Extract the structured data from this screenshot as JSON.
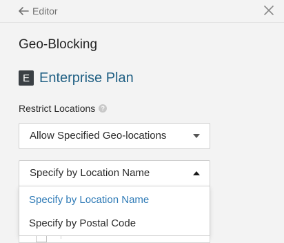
{
  "topbar": {
    "back_label": "Editor",
    "back_icon": "arrow-left-icon",
    "close_icon": "close-icon"
  },
  "page": {
    "title": "Geo-Blocking"
  },
  "plan": {
    "badge": "E",
    "name": "Enterprise Plan",
    "badge_color": "#3a3f44",
    "name_color": "#1f5f83"
  },
  "restrict": {
    "label": "Restrict Locations",
    "help_icon": "help-icon",
    "geo_select_value": "Allow Specified Geo-locations",
    "method_select_value": "Specify by Location Name",
    "method_options": [
      {
        "label": "Specify by Location Name",
        "selected": true
      },
      {
        "label": "Specify by Postal Code",
        "selected": false
      }
    ]
  },
  "colors": {
    "accent": "#2e7ab6",
    "background": "#f3f3f3"
  }
}
